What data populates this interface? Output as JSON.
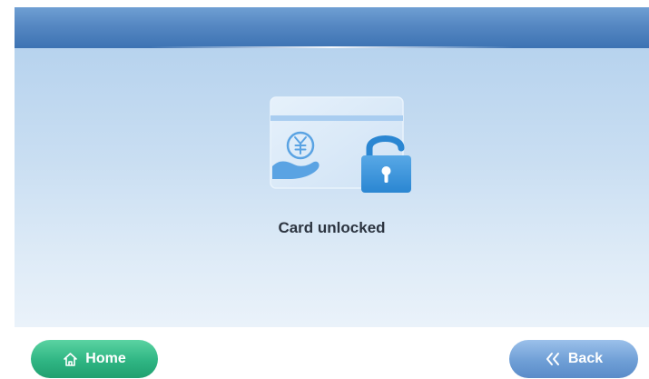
{
  "status": {
    "message": "Card unlocked"
  },
  "buttons": {
    "home_label": "Home",
    "back_label": "Back"
  },
  "icons": {
    "illustration": "card-unlocked-illustration",
    "home": "home-icon",
    "back": "double-chevron-left-icon",
    "currency": "yuan-icon",
    "lock": "open-lock-icon"
  },
  "colors": {
    "header": "#4a7dbb",
    "content_bg": "#c9def2",
    "message_text": "#2c3440",
    "home_button": "#2fb583",
    "back_button": "#6f9fd6"
  }
}
